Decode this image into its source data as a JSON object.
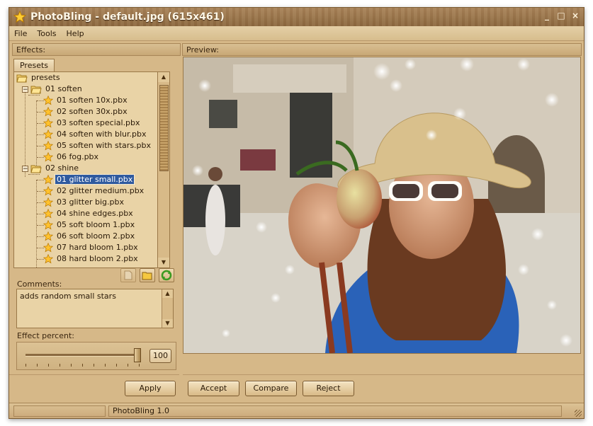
{
  "window": {
    "title": "PhotoBling - default.jpg (615x461)",
    "controls": [
      "_",
      "□",
      "×"
    ]
  },
  "menu": {
    "items": [
      "File",
      "Tools",
      "Help"
    ]
  },
  "left_panel": {
    "header": "Effects:",
    "tab": "Presets",
    "tree": {
      "root": "presets",
      "groups": [
        {
          "name": "01 soften",
          "items": [
            "01 soften 10x.pbx",
            "02 soften 30x.pbx",
            "03 soften special.pbx",
            "04 soften with blur.pbx",
            "05 soften with stars.pbx",
            "06 fog.pbx"
          ]
        },
        {
          "name": "02 shine",
          "items": [
            "01 glitter small.pbx",
            "02 glitter medium.pbx",
            "03 glitter big.pbx",
            "04 shine edges.pbx",
            "05 soft bloom 1.pbx",
            "06 soft bloom 2.pbx",
            "07 hard bloom 1.pbx",
            "08 hard bloom 2.pbx"
          ]
        }
      ],
      "selected": "01 glitter small.pbx"
    },
    "comments_label": "Comments:",
    "comments_text": "adds random small stars",
    "effect_label": "Effect percent:",
    "effect_value": "100",
    "effect_percent": 100,
    "apply_label": "Apply"
  },
  "preview": {
    "header": "Preview:"
  },
  "actions": {
    "accept": "Accept",
    "compare": "Compare",
    "reject": "Reject"
  },
  "status": {
    "left": "",
    "app": "PhotoBling 1.0"
  }
}
